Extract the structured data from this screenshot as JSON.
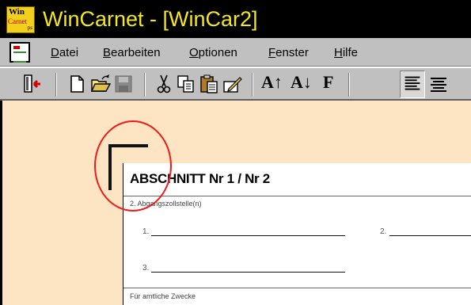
{
  "window": {
    "title": "WinCarnet - [WinCar2]",
    "logo": {
      "line1": "Win",
      "line2": "Carnet",
      "line3": "ps"
    }
  },
  "menu": {
    "items": [
      {
        "mnemonic": "D",
        "rest": "atei"
      },
      {
        "mnemonic": "B",
        "rest": "earbeiten"
      },
      {
        "mnemonic": "O",
        "rest": "ptionen"
      },
      {
        "mnemonic": "F",
        "rest": "enster"
      },
      {
        "mnemonic": "H",
        "rest": "ilfe"
      }
    ]
  },
  "toolbar": {
    "buttons": [
      "exit-icon",
      "new-document-icon",
      "open-folder-icon",
      "save-icon",
      "cut-icon",
      "copy-icon",
      "paste-icon",
      "edit-icon",
      "font-larger-icon",
      "font-smaller-icon",
      "bold-icon",
      "align-left-icon",
      "align-center-icon"
    ],
    "font_larger": "A↑",
    "font_smaller": "A↓",
    "bold": "F"
  },
  "form": {
    "title": "ABSCHNITT Nr 1 / Nr 2",
    "field_label": "2. Abgangszollstelle(n)",
    "line_numbers": [
      "1.",
      "2.",
      "3."
    ],
    "footer_label": "Für amtliche Zwecke"
  },
  "colors": {
    "titlebar": "#000000",
    "title_text": "#f4e81a",
    "chrome": "#c0c0c0",
    "workspace": "#fde4c2",
    "annotation_circle": "#ee1a1a"
  }
}
